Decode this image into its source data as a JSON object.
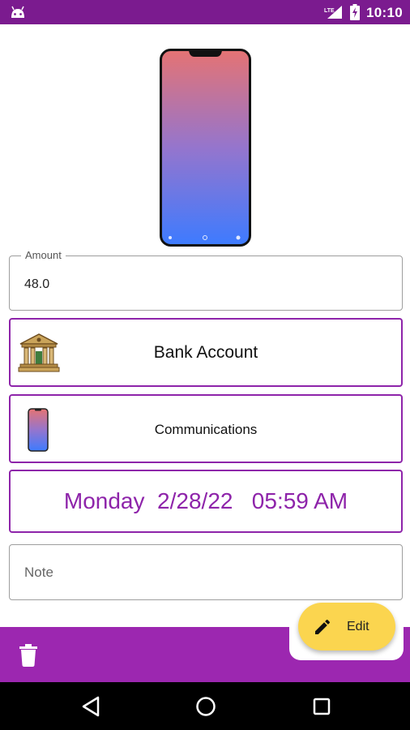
{
  "status_bar": {
    "time": "10:10",
    "icons": [
      "android-icon",
      "signal-lte-icon",
      "battery-charging-icon"
    ]
  },
  "header_image": {
    "icon": "phone-illustration"
  },
  "amount": {
    "label": "Amount",
    "value": "48.0"
  },
  "account": {
    "label": "Bank Account",
    "icon": "bank-icon"
  },
  "category": {
    "label": "Communications",
    "icon": "phone-icon"
  },
  "datetime": {
    "text": "Monday  2/28/22   05:59 AM"
  },
  "note": {
    "placeholder": "Note"
  },
  "bottom_bar": {
    "delete_icon": "trash-icon",
    "edit_label": "Edit",
    "edit_icon": "pencil-icon"
  },
  "nav_bar": {
    "icons": [
      "back-icon",
      "home-icon",
      "recents-icon"
    ]
  },
  "colors": {
    "status_bar": "#7b1b8f",
    "accent": "#8e24aa",
    "bottom_bar": "#9c27b0",
    "fab": "#fbd54f",
    "gradient_top": "#e57373",
    "gradient_bottom": "#3d7bff"
  }
}
